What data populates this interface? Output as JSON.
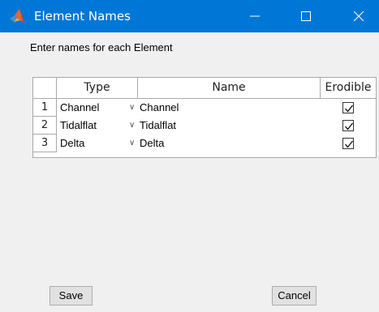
{
  "window": {
    "title": "Element Names",
    "icon": "matlab-icon"
  },
  "instruction": "Enter names for each Element",
  "table": {
    "columns": [
      "Type",
      "Name",
      "Erodible"
    ],
    "rows": [
      {
        "num": "1",
        "type": "Channel",
        "name": "Channel",
        "erodible": true
      },
      {
        "num": "2",
        "type": "Tidalflat",
        "name": "Tidalflat",
        "erodible": true
      },
      {
        "num": "3",
        "type": "Delta",
        "name": "Delta",
        "erodible": true
      }
    ]
  },
  "buttons": {
    "save": "Save",
    "cancel": "Cancel"
  },
  "colors": {
    "titlebar": "#0077d6",
    "window_bg": "#f0f0f0"
  }
}
